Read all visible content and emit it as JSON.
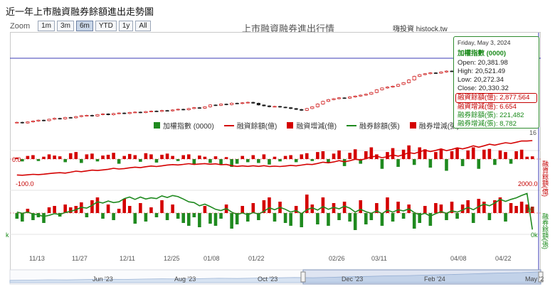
{
  "page": {
    "title": "近一年上市融資融券餘額進出走勢圖"
  },
  "zoom": {
    "label": "Zoom",
    "buttons": [
      "1m",
      "3m",
      "6m",
      "YTD",
      "1y",
      "All"
    ],
    "active": "6m"
  },
  "header": {
    "title": "上市融資融券進出行情",
    "source": "嗨投資 histock.tw"
  },
  "tooltip": {
    "date": "Friday, May 3, 2024",
    "series": "加權指數 (0000)",
    "open": "Open: 20,381.98",
    "high": "High: 20,521.49",
    "low": "Low: 20,272.34",
    "close": "Close: 20,330.32",
    "margin_balance": "融資餘額(億): 2,877.564",
    "margin_change": "融資增減(億): 6.654",
    "short_balance": "融券餘額(張): 221,482",
    "short_change": "融券增減(張): 8,782"
  },
  "colors": {
    "up": "#d40000",
    "down": "#1f8a1f",
    "margin_line": "#d40000",
    "short_line": "#1f8a1f",
    "crosshair": "#3b3bb5"
  },
  "chart_data": {
    "type": "candlestick+bar+line",
    "legend": [
      "加權指數 (0000)",
      "融資餘額(億)",
      "融資增減(億)",
      "融券餘額(張)",
      "融券增減(張)"
    ],
    "x_ticks": [
      "11/13",
      "11/27",
      "12/11",
      "12/25",
      "01/08",
      "01/22",
      "02/26",
      "03/11",
      "04/08",
      "04/22"
    ],
    "navigator_ticks": [
      "Jun '23",
      "Aug '23",
      "Oct '23",
      "Dec '23",
      "Feb '24",
      "May '2"
    ],
    "left_axis_labels": [
      "0.0",
      "-100.0",
      "k"
    ],
    "right_axis_labels": [
      "16",
      "2000.0",
      "20",
      "0k"
    ],
    "right_axis_titles": [
      "融資餘額(億)",
      "融券餘額(張)"
    ],
    "index_close": [
      17330,
      17290,
      17350,
      17400,
      17450,
      17420,
      17500,
      17550,
      17520,
      17600,
      17580,
      17650,
      17700,
      17720,
      17680,
      17760,
      17800,
      17750,
      17820,
      17850,
      17820,
      17880,
      17900,
      17870,
      17930,
      17960,
      17940,
      17990,
      17970,
      18020,
      18060,
      18030,
      18100,
      18150,
      18120,
      18200,
      18300,
      18280,
      18350,
      18320,
      18400,
      18380,
      18420,
      18450,
      18400,
      18300,
      18250,
      18200,
      18220,
      18180,
      18150,
      18100,
      18050,
      18000,
      18100,
      18200,
      18350,
      18500,
      18600,
      18650,
      18700,
      18680,
      18750,
      18800,
      18850,
      18900,
      19000,
      19150,
      19250,
      19300,
      19350,
      19450,
      19550,
      19700,
      19900,
      20000,
      20050,
      20100,
      20080,
      20150,
      20200,
      20180,
      20250,
      20300,
      20350,
      20400,
      20380,
      20420,
      20450,
      20380,
      20300,
      20150,
      20000,
      20100,
      20250,
      20300,
      20330
    ],
    "margin_change_yi": [
      4,
      -6,
      8,
      10,
      -5,
      6,
      12,
      9,
      7,
      -8,
      15,
      18,
      -10,
      12,
      14,
      -6,
      9,
      11,
      16,
      -12,
      8,
      13,
      10,
      -7,
      15,
      12,
      -9,
      11,
      14,
      8,
      -5,
      10,
      12,
      -14,
      9,
      6,
      -10,
      7,
      -15,
      5,
      -20,
      -12,
      8,
      -8,
      10,
      -10,
      12,
      -14,
      6,
      -6,
      8,
      10,
      -8,
      12,
      15,
      -5,
      18,
      20,
      -10,
      14,
      22,
      -18,
      16,
      25,
      -12,
      20,
      30,
      12,
      -25,
      18,
      28,
      -20,
      24,
      35,
      -15,
      30,
      25,
      -22,
      18,
      26,
      -30,
      20,
      28,
      -18,
      22,
      30,
      -25,
      24,
      26,
      -15,
      22,
      18,
      -12,
      20,
      24,
      6,
      7
    ],
    "margin_balance_yi": [
      2340,
      2335,
      2342,
      2350,
      2346,
      2352,
      2362,
      2370,
      2376,
      2369,
      2383,
      2400,
      2391,
      2403,
      2416,
      2410,
      2419,
      2429,
      2444,
      2433,
      2440,
      2452,
      2462,
      2455,
      2469,
      2480,
      2472,
      2482,
      2495,
      2502,
      2497,
      2506,
      2517,
      2504,
      2512,
      2518,
      2508,
      2515,
      2500,
      2505,
      2486,
      2474,
      2482,
      2474,
      2484,
      2474,
      2486,
      2472,
      2478,
      2472,
      2480,
      2490,
      2482,
      2494,
      2508,
      2503,
      2520,
      2540,
      2530,
      2543,
      2564,
      2547,
      2562,
      2586,
      2575,
      2594,
      2623,
      2634,
      2610,
      2627,
      2653,
      2634,
      2657,
      2690,
      2676,
      2704,
      2727,
      2707,
      2724,
      2748,
      2720,
      2739,
      2765,
      2748,
      2769,
      2797,
      2774,
      2797,
      2821,
      2807,
      2827,
      2844,
      2833,
      2852,
      2872,
      2871,
      2878
    ],
    "short_change_zhang": [
      -8,
      -12,
      6,
      -10,
      -6,
      -14,
      8,
      10,
      -5,
      12,
      8,
      10,
      15,
      -6,
      18,
      22,
      -8,
      12,
      -10,
      6,
      20,
      10,
      -15,
      14,
      -12,
      8,
      -6,
      18,
      -10,
      12,
      -8,
      -14,
      -18,
      -6,
      -20,
      10,
      -15,
      -18,
      -8,
      12,
      -22,
      -16,
      10,
      -12,
      14,
      -10,
      18,
      22,
      -12,
      16,
      -14,
      -18,
      10,
      -20,
      26,
      12,
      -16,
      22,
      -18,
      14,
      -10,
      16,
      -12,
      -24,
      18,
      -16,
      -10,
      14,
      -18,
      22,
      -12,
      16,
      -8,
      12,
      -22,
      -14,
      10,
      -18,
      14,
      12,
      -10,
      16,
      -8,
      12,
      18,
      -14,
      20,
      16,
      -10,
      18,
      22,
      -12,
      14,
      10,
      16,
      12,
      9
    ],
    "short_balance_zhang": [
      265,
      262,
      265,
      260,
      258,
      254,
      257,
      261,
      259,
      264,
      267,
      271,
      277,
      275,
      282,
      291,
      288,
      293,
      289,
      291,
      299,
      303,
      297,
      303,
      298,
      301,
      299,
      306,
      302,
      307,
      304,
      298,
      291,
      289,
      281,
      285,
      279,
      272,
      269,
      274,
      265,
      259,
      263,
      258,
      264,
      260,
      267,
      276,
      271,
      277,
      272,
      265,
      269,
      261,
      271,
      276,
      270,
      279,
      272,
      277,
      273,
      280,
      275,
      265,
      272,
      266,
      262,
      268,
      261,
      270,
      265,
      271,
      268,
      273,
      264,
      258,
      262,
      255,
      261,
      266,
      262,
      268,
      265,
      270,
      277,
      271,
      279,
      285,
      281,
      288,
      297,
      292,
      297,
      301,
      307,
      312,
      221
    ]
  }
}
